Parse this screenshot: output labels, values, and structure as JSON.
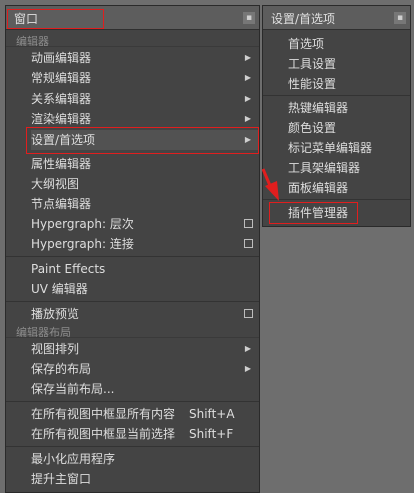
{
  "main_menu": {
    "title": "窗口",
    "tear_icon": "tear-off-icon",
    "sections": {
      "editors": "编辑器",
      "layouts": "编辑器布局"
    },
    "items": {
      "animation_editors": "动画编辑器",
      "general_editors": "常规编辑器",
      "relationship_editors": "关系编辑器",
      "rendering_editors": "渲染编辑器",
      "settings_preferences": "设置/首选项",
      "attribute_editor": "属性编辑器",
      "outliner": "大纲视图",
      "node_editor": "节点编辑器",
      "hypergraph_hierarchy": "Hypergraph: 层次",
      "hypergraph_connections": "Hypergraph: 连接",
      "paint_effects": "Paint Effects",
      "uv_editor": "UV 编辑器",
      "playblast": "播放预览",
      "view_arrangement": "视图排列",
      "saved_layouts": "保存的布局",
      "save_current_layout": "保存当前布局...",
      "frame_all": "在所有视图中框显所有内容",
      "frame_all_shortcut": "Shift+A",
      "frame_selected": "在所有视图中框显当前选择",
      "frame_selected_shortcut": "Shift+F",
      "minimize_app": "最小化应用程序",
      "raise_main_window": "提升主窗口"
    }
  },
  "sub_menu": {
    "title": "设置/首选项",
    "tear_icon": "tear-off-icon",
    "items": {
      "preferences": "首选项",
      "tool_settings": "工具设置",
      "performance_settings": "性能设置",
      "hotkey_editor": "热键编辑器",
      "color_settings": "颜色设置",
      "marking_menu_editor": "标记菜单编辑器",
      "shelf_editor": "工具架编辑器",
      "panel_editor": "面板编辑器",
      "plugin_manager": "插件管理器"
    }
  },
  "colors": {
    "highlight_red": "#e01e1e",
    "menu_bg": "#444444",
    "title_bg": "#5d5d5d"
  },
  "icons": {
    "submenu_arrow": "chevron-right-icon",
    "option_box": "option-box-icon",
    "annotation_arrow": "red-arrow-icon"
  }
}
